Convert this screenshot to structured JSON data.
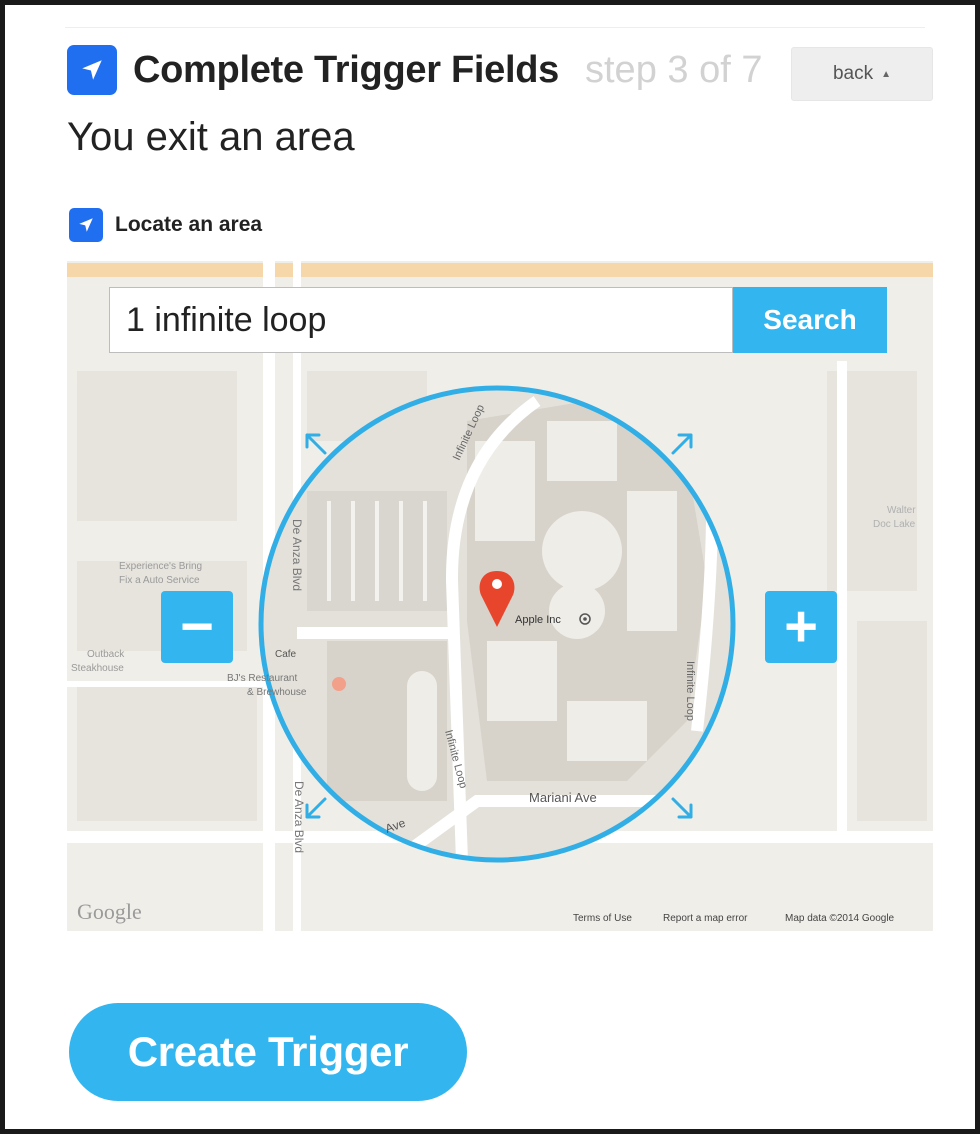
{
  "header": {
    "title": "Complete Trigger Fields",
    "step": "step 3 of 7",
    "back_label": "back",
    "icon": "location-arrow-icon"
  },
  "trigger": {
    "name": "You exit an area"
  },
  "field": {
    "label": "Locate an area",
    "icon": "location-arrow-icon"
  },
  "map": {
    "search": {
      "value": "1 infinite loop",
      "button_label": "Search"
    },
    "zoom_out_label": "−",
    "zoom_in_label": "+",
    "marker_label": "Apple Inc",
    "streets": {
      "de_anza": "De Anza Blvd",
      "infinite_loop": "Infinite Loop",
      "mariani": "Mariani Ave",
      "ave": "Ave"
    },
    "places": {
      "experience": "Experience's Bring",
      "fix_auto": "Fix a Auto Service",
      "outback": "Outback",
      "steakhouse": "Steakhouse",
      "cafe": "Cafe",
      "bjs": "BJ's Restaurant",
      "brewhouse": "& Brewhouse",
      "walter": "Walter",
      "doc_lake": "Doc Lake"
    },
    "google_logo": "Google",
    "terms": "Terms of Use",
    "report": "Report a map error",
    "map_data": "Map data ©2014 Google"
  },
  "colors": {
    "accent": "#33b5ef",
    "icon_blue": "#1f6ff0",
    "marker_red": "#e8452d"
  },
  "footer": {
    "create_label": "Create Trigger"
  }
}
